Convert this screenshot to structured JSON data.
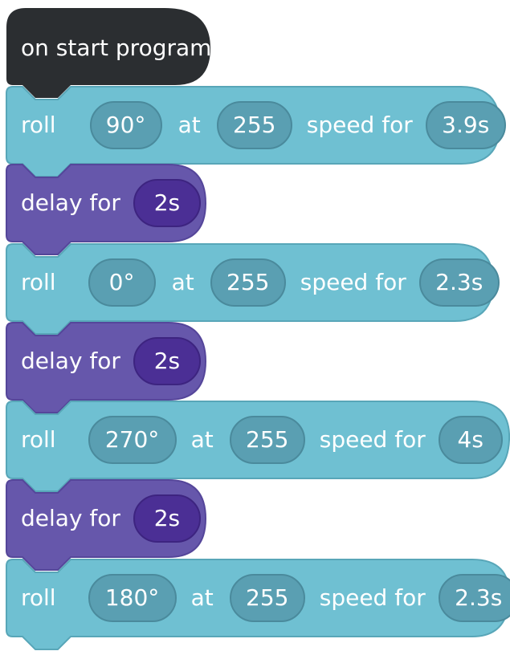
{
  "colors": {
    "start": "#2b2e31",
    "roll": "#6fc0d2",
    "roll_edge": "#58a6b8",
    "roll_pill": "#5a9fb2",
    "delay": "#6657ab",
    "delay_edge": "#55469a",
    "delay_pill": "#4b2f95"
  },
  "start": {
    "label": "on start program"
  },
  "blocks": [
    {
      "type": "roll",
      "word": "roll",
      "heading": "90°",
      "at": "at",
      "speed": "255",
      "speed_for": "speed for",
      "duration": "3.9s"
    },
    {
      "type": "delay",
      "word": "delay for",
      "duration": "2s"
    },
    {
      "type": "roll",
      "word": "roll",
      "heading": "0°",
      "at": "at",
      "speed": "255",
      "speed_for": "speed for",
      "duration": "2.3s"
    },
    {
      "type": "delay",
      "word": "delay for",
      "duration": "2s"
    },
    {
      "type": "roll",
      "word": "roll",
      "heading": "270°",
      "at": "at",
      "speed": "255",
      "speed_for": "speed for",
      "duration": "4s"
    },
    {
      "type": "delay",
      "word": "delay for",
      "duration": "2s"
    },
    {
      "type": "roll",
      "word": "roll",
      "heading": "180°",
      "at": "at",
      "speed": "255",
      "speed_for": "speed for",
      "duration": "2.3s"
    }
  ]
}
